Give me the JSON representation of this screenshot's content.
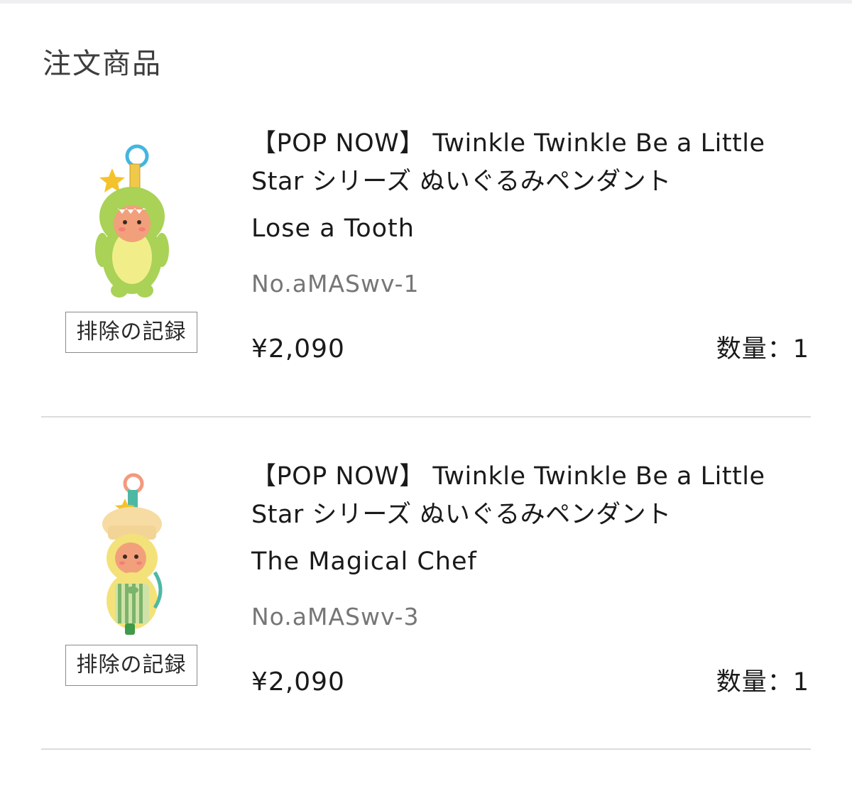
{
  "section_title": "注文商品",
  "items": [
    {
      "title": "【POP NOW】 Twinkle Twinkle Be a Little\nStar シリーズ ぬいぐるみペンダント",
      "variant": "Lose a Tooth",
      "sku": "No.aMASwv-1",
      "price": "¥2,090",
      "quantity": "数量：1",
      "remove_label": "排除の記録",
      "image_icon": "green-dinosaur-plush-pendant-image",
      "colors": {
        "body": "#a9d257",
        "belly": "#f1ee8a",
        "ring": "#43b6e0",
        "star": "#f6c22b"
      }
    },
    {
      "title": "【POP NOW】 Twinkle Twinkle Be a Little\nStar シリーズ ぬいぐるみペンダント",
      "variant": "The Magical Chef",
      "sku": "No.aMASwv-3",
      "price": "¥2,090",
      "quantity": "数量：1",
      "remove_label": "排除の記録",
      "image_icon": "chef-plush-pendant-image",
      "colors": {
        "body": "#f3e27a",
        "hat": "#f6dca3",
        "ring": "#f29a7f",
        "apron": "#7bb46a"
      }
    }
  ]
}
